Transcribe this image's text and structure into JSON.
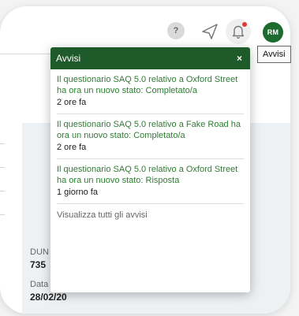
{
  "header": {
    "help_label": "?",
    "avatar_initials": "RM",
    "tooltip": "Avvisi"
  },
  "popup": {
    "title": "Avvisi",
    "close_label": "×",
    "notifications": [
      {
        "text": "Il questionario SAQ 5.0 relativo a Oxford Street ha ora un nuovo stato: Completato/a",
        "time": "2 ore fa"
      },
      {
        "text": "Il questionario SAQ 5.0 relativo a Fake Road ha ora un nuovo stato: Completato/a",
        "time": "2 ore fa"
      },
      {
        "text": "Il questionario SAQ 5.0 relativo a Oxford Street ha ora un nuovo stato: Risposta",
        "time": "1 giorno fa"
      }
    ],
    "view_all": "Visualizza tutti gli avvisi"
  },
  "background": {
    "label_1": "DUN",
    "value_1": "735",
    "label_2": "Data",
    "value_2": "28/02/20"
  },
  "colors": {
    "header_green": "#1f5a2a",
    "link_green": "#2e7d32",
    "avatar_green": "#1d6b2f",
    "notification_dot": "#e53935"
  }
}
